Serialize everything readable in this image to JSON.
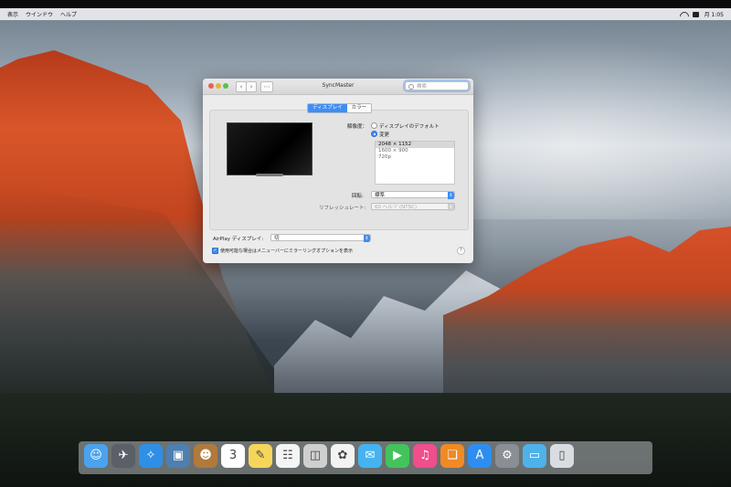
{
  "menubar": {
    "items": [
      "表示",
      "ウインドウ",
      "ヘルプ"
    ],
    "clock": "月 1:05"
  },
  "window": {
    "title": "SyncMaster",
    "search_placeholder": "検索",
    "tabs": [
      {
        "label": "ディスプレイ",
        "active": true
      },
      {
        "label": "カラー",
        "active": false
      }
    ],
    "resolution": {
      "label": "解像度：",
      "option_default": "ディスプレイのデフォルト",
      "option_scaled": "変更",
      "selected_option": "変更",
      "list": [
        "2048 × 1152",
        "1600 × 900",
        "720p"
      ],
      "selected": "2048 × 1152"
    },
    "rotation": {
      "label": "回転:",
      "value": "標準"
    },
    "refresh": {
      "label": "リフレッシュレート:",
      "value": "60 ヘルツ (NTSC)",
      "enabled": false
    },
    "airplay": {
      "label": "AirPlay ディスプレイ:",
      "value": "切"
    },
    "mirror_option": {
      "label": "使用可能な場合はメニューバーにミラーリングオプションを表示",
      "checked": true
    },
    "help": "?"
  },
  "dock": {
    "apps": [
      {
        "name": "finder-icon",
        "glyph": "☺",
        "color": "#4aa3ee"
      },
      {
        "name": "launchpad-icon",
        "glyph": "✈",
        "color": "#5a5f68"
      },
      {
        "name": "safari-icon",
        "glyph": "✧",
        "color": "#2f8fe6"
      },
      {
        "name": "preview-icon",
        "glyph": "▣",
        "color": "#4d7fb0"
      },
      {
        "name": "contacts-icon",
        "glyph": "☻",
        "color": "#b07a3c"
      },
      {
        "name": "calendar-icon",
        "glyph": "3",
        "color": "#ffffff"
      },
      {
        "name": "notes-icon",
        "glyph": "✎",
        "color": "#f6d65a"
      },
      {
        "name": "reminders-icon",
        "glyph": "☷",
        "color": "#f5f5f5"
      },
      {
        "name": "photo-booth-icon",
        "glyph": "◫",
        "color": "#cfcfcf"
      },
      {
        "name": "photos-icon",
        "glyph": "✿",
        "color": "#f3f3f3"
      },
      {
        "name": "messages-icon",
        "glyph": "✉",
        "color": "#45b3f0"
      },
      {
        "name": "facetime-icon",
        "glyph": "▶",
        "color": "#42c45a"
      },
      {
        "name": "itunes-icon",
        "glyph": "♫",
        "color": "#f24d8c"
      },
      {
        "name": "ibooks-icon",
        "glyph": "❏",
        "color": "#f08a24"
      },
      {
        "name": "app-store-icon",
        "glyph": "A",
        "color": "#2d8ef0"
      },
      {
        "name": "system-preferences-icon",
        "glyph": "⚙",
        "color": "#8a8f96"
      },
      {
        "name": "folder-icon",
        "glyph": "▭",
        "color": "#4fb1ea"
      },
      {
        "name": "trash-icon",
        "glyph": "▯",
        "color": "#d9dde2"
      }
    ]
  }
}
